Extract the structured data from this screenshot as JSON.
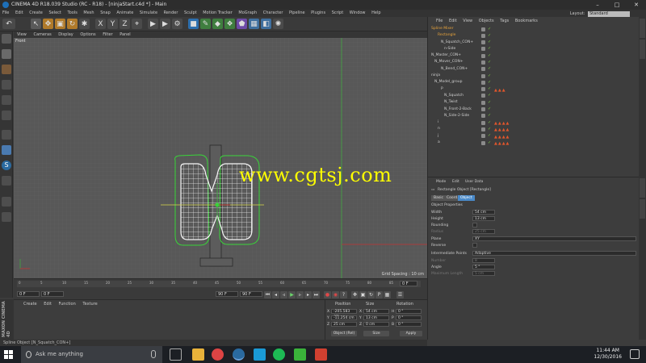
{
  "window": {
    "title": "CINEMA 4D R18.039 Studio (RC - R18) - [ninjaStart.c4d *] - Main",
    "controls": [
      "–",
      "□",
      "✕"
    ]
  },
  "menubar": {
    "items": [
      "File",
      "Edit",
      "Create",
      "Select",
      "Tools",
      "Mesh",
      "Snap",
      "Animate",
      "Simulate",
      "Render",
      "Sculpt",
      "Motion Tracker",
      "MoGraph",
      "Character",
      "Pipeline",
      "Plugins",
      "Script",
      "Window",
      "Help"
    ],
    "layout_label": "Layout:",
    "layout_value": "Standard"
  },
  "viewport": {
    "menu": [
      "View",
      "Cameras",
      "Display",
      "Options",
      "Filter",
      "Panel"
    ],
    "label": "Front",
    "grid_spacing": "Grid Spacing : 10 cm",
    "watermark": "www.cgtsj.com"
  },
  "timeline": {
    "ticks": [
      "0",
      "5",
      "10",
      "15",
      "20",
      "25",
      "30",
      "35",
      "40",
      "45",
      "50",
      "55",
      "60",
      "65",
      "70",
      "75",
      "80",
      "85",
      "90"
    ],
    "end_frame": "0 F",
    "start_field": "0 F",
    "min_field": "0 F",
    "max_field": "90 F",
    "max_field2": "90 F"
  },
  "material_manager": {
    "menu": [
      "Create",
      "Edit",
      "Function",
      "Texture"
    ]
  },
  "maxon": {
    "logo": "MAXON CINEMA 4D"
  },
  "coordinates": {
    "headers": [
      "Position",
      "Size",
      "Rotation"
    ],
    "rows": [
      {
        "axis": "X",
        "pos": "-205.583 cm",
        "size_axis": "X",
        "size": "54 cm",
        "rot_axis": "H",
        "rot": "0 °"
      },
      {
        "axis": "Y",
        "pos": "-11.254 cm",
        "size_axis": "Y",
        "size": "13 cm",
        "rot_axis": "P",
        "rot": "0 °"
      },
      {
        "axis": "Z",
        "pos": "25 cm",
        "size_axis": "Z",
        "size": "0 cm",
        "rot_axis": "B",
        "rot": "0 °"
      }
    ],
    "mode1": "Object (Rel)",
    "mode2": "Size",
    "apply": "Apply"
  },
  "status": "Spline Object [N_Squatch_CON+]",
  "object_manager": {
    "menu": [
      "File",
      "Edit",
      "View",
      "Objects",
      "Tags",
      "Bookmarks"
    ],
    "objects": [
      {
        "name": "Spline Mixer",
        "indent": 4,
        "color": "#e8a33b",
        "tags": ""
      },
      {
        "name": "Rectangle",
        "indent": 12,
        "color": "#e8a33b",
        "tags": ""
      },
      {
        "name": "N_Squatch_CON+",
        "indent": 16,
        "color": "#cfcfcf",
        "tags": ""
      },
      {
        "name": "n-Side",
        "indent": 20,
        "color": "#cfcfcf",
        "tags": ""
      },
      {
        "name": "N_Master_CON+",
        "indent": 4,
        "color": "#cfcfcf",
        "tags": ""
      },
      {
        "name": "N_Mover_CON+",
        "indent": 8,
        "color": "#cfcfcf",
        "tags": ""
      },
      {
        "name": "N_Bend_CON+",
        "indent": 16,
        "color": "#cfcfcf",
        "tags": ""
      },
      {
        "name": "ninja",
        "indent": 4,
        "color": "#cfcfcf",
        "tags": ""
      },
      {
        "name": "N_Model_group",
        "indent": 8,
        "color": "#cfcfcf",
        "tags": ""
      },
      {
        "name": "P",
        "indent": 16,
        "color": "#cfcfcf",
        "tags": "▲▲▲"
      },
      {
        "name": "N_Squatch",
        "indent": 20,
        "color": "#cfcfcf",
        "tags": ""
      },
      {
        "name": "N_Twist",
        "indent": 20,
        "color": "#cfcfcf",
        "tags": ""
      },
      {
        "name": "N_Front-2-Back",
        "indent": 20,
        "color": "#cfcfcf",
        "tags": ""
      },
      {
        "name": "N_Side-2-Side",
        "indent": 20,
        "color": "#cfcfcf",
        "tags": ""
      },
      {
        "name": "i",
        "indent": 12,
        "color": "#cfcfcf",
        "tags": "▲▲▲▲"
      },
      {
        "name": "n",
        "indent": 12,
        "color": "#cfcfcf",
        "tags": "▲▲▲▲"
      },
      {
        "name": "j",
        "indent": 12,
        "color": "#cfcfcf",
        "tags": "▲▲▲▲"
      },
      {
        "name": "a",
        "indent": 12,
        "color": "#cfcfcf",
        "tags": "▲▲▲▲"
      }
    ]
  },
  "attribute_manager": {
    "menu": [
      "Mode",
      "Edit",
      "User Data"
    ],
    "object_title": "Rectangle Object [Rectangle]",
    "tabs": [
      "Basic",
      "Coord.",
      "Object"
    ],
    "section": "Object Properties",
    "fields": [
      {
        "label": "Width",
        "value": "54 cm"
      },
      {
        "label": "Height",
        "value": "13 cm"
      },
      {
        "label": "Rounding",
        "value": ""
      },
      {
        "label": "Radius",
        "value": "25 cm"
      },
      {
        "label": "Plane",
        "value": "XY"
      },
      {
        "label": "Reverse",
        "value": ""
      },
      {
        "label": "Intermediate Points",
        "value": "Adaptive"
      },
      {
        "label": "Number",
        "value": "8"
      },
      {
        "label": "Angle",
        "value": "5 °"
      },
      {
        "label": "Maximum Length",
        "value": "5 cm"
      }
    ]
  },
  "taskbar": {
    "search_placeholder": "Ask me anything",
    "time": "11:44 AM",
    "date": "12/30/2016"
  }
}
